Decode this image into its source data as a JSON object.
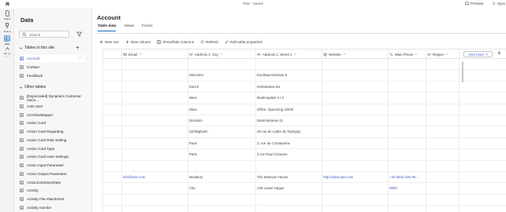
{
  "titlebar": {
    "title": "Test - Saved",
    "preview": "Preview",
    "sync": "Sync"
  },
  "rail": [
    {
      "label": "Pages",
      "icon": "page-icon"
    },
    {
      "label": "Styling",
      "icon": "styling-icon"
    },
    {
      "label": "Data",
      "icon": "data-icon",
      "active": true
    },
    {
      "label": "Set up",
      "icon": "setup-icon"
    }
  ],
  "rail_more": "···",
  "panel": {
    "title": "Data",
    "search_placeholder": "Search",
    "section_tables_in_site": "Tables in this site",
    "site_tables": [
      {
        "label": "Account",
        "active": true
      },
      {
        "label": "Contact"
      },
      {
        "label": "Feedback"
      }
    ],
    "section_other_tables": "Other tables",
    "other_tables": [
      {
        "label": "[Deprecated] Dynamics Customer Voice..."
      },
      {
        "label": "AAD User"
      },
      {
        "label": "ACIViewMapper"
      },
      {
        "label": "Action Card"
      },
      {
        "label": "Action Card Regarding"
      },
      {
        "label": "Action Card Role Setting"
      },
      {
        "label": "Action Card Type"
      },
      {
        "label": "Action Card User Settings"
      },
      {
        "label": "Action Input Parameter"
      },
      {
        "label": "Action Output Parameter"
      },
      {
        "label": "ActionCardUserState"
      },
      {
        "label": "Activity"
      },
      {
        "label": "Activity File Attachment"
      },
      {
        "label": "Activity monitor"
      }
    ],
    "dots": "···"
  },
  "main": {
    "heading": "Account",
    "tabs": [
      {
        "label": "Table data",
        "active": true
      },
      {
        "label": "Views"
      },
      {
        "label": "Forms"
      }
    ],
    "toolbar": [
      {
        "label": "New row",
        "icon": "plus-icon"
      },
      {
        "label": "New column",
        "icon": "plus-icon"
      },
      {
        "label": "Show/hide columns",
        "icon": "columns-icon"
      },
      {
        "label": "Refresh",
        "icon": "refresh-icon"
      },
      {
        "label": "Edit table properties",
        "icon": "edit-icon"
      }
    ]
  },
  "grid": {
    "columns": [
      {
        "label": "Email",
        "icon": "mail-icon"
      },
      {
        "label": "Address 1: City",
        "icon": "text-icon"
      },
      {
        "label": "Address 1: Street 1",
        "icon": "text-icon"
      },
      {
        "label": "Website",
        "icon": "globe-icon"
      },
      {
        "label": "Main Phone",
        "icon": "phone-icon"
      },
      {
        "label": "Region",
        "icon": "text-icon"
      }
    ],
    "more_label": "+164 more",
    "rows": [
      [
        "",
        "",
        "",
        "",
        "",
        ""
      ],
      [
        "",
        "München",
        "Kurzbauerstrasse 8",
        "",
        "",
        ""
      ],
      [
        "",
        "Zürich",
        "Holzstrasse 84",
        "",
        "",
        ""
      ],
      [
        "",
        "Wien",
        "Brahmsplatz 2 / 2",
        "",
        "",
        ""
      ],
      [
        "",
        "Wien",
        "Office: Opernring 1/R/III",
        "",
        "",
        ""
      ],
      [
        "",
        "Dornbirn",
        "Dammstrasse 41",
        "",
        "",
        ""
      ],
      [
        "",
        "Schiltigheim",
        "28 rue de Lattre de Tassigny",
        "",
        "",
        ""
      ],
      [
        "",
        "Paris",
        "3, rue de Constantine",
        "",
        "",
        ""
      ],
      [
        "",
        "Paris",
        "3 rue Paul Cézanne",
        "",
        "",
        ""
      ],
      [
        "",
        "",
        "",
        "",
        "",
        ""
      ],
      [
        "info@2a2.com",
        "Newbury",
        "The Mansion House",
        "http://www.2a2.com",
        "+44 0844 225 05...",
        ""
      ],
      [
        "",
        "City",
        "129 Lower Hague",
        "",
        "0000",
        ""
      ],
      [
        "",
        "",
        "",
        "",
        "",
        ""
      ]
    ]
  },
  "colors": {
    "accent": "#0f6cbd",
    "link": "#3f58c6",
    "panel_bg": "#f7f7f7",
    "rail_bg": "#f3f3f3"
  }
}
